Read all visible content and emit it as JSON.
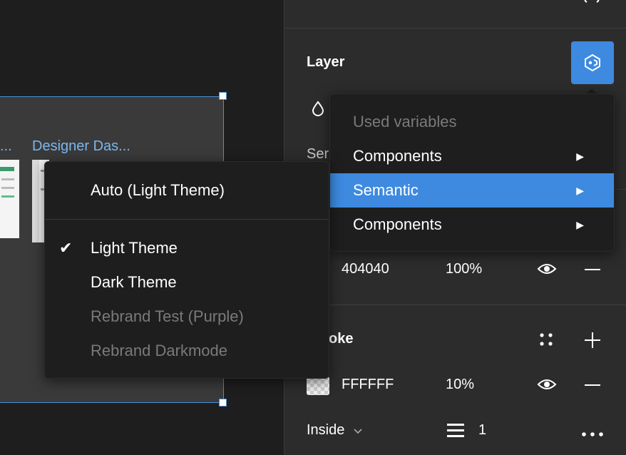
{
  "canvas": {
    "frame_titles": [
      "...",
      "Designer Das..."
    ]
  },
  "panel": {
    "layer": {
      "title": "Layer"
    },
    "section_partial": "Ser",
    "fill": {
      "hex": "404040",
      "opacity": "100%"
    },
    "stroke": {
      "title": "Stroke",
      "visible_title": "oke",
      "hex": "FFFFFF",
      "opacity": "10%",
      "position": "Inside",
      "weight": "1"
    }
  },
  "variables_menu": {
    "header": "Used variables",
    "items": [
      {
        "label": "Components",
        "selected": false
      },
      {
        "label": "Semantic",
        "selected": true
      },
      {
        "label": "Components",
        "selected": false
      }
    ]
  },
  "mode_menu": {
    "items": [
      {
        "label": "Auto (Light Theme)",
        "checked": false,
        "disabled": false
      },
      {
        "label": "Light Theme",
        "checked": true,
        "disabled": false
      },
      {
        "label": "Dark Theme",
        "checked": false,
        "disabled": false
      },
      {
        "label": "Rebrand Test (Purple)",
        "checked": false,
        "disabled": true
      },
      {
        "label": "Rebrand Darkmode",
        "checked": false,
        "disabled": true
      }
    ]
  },
  "colors": {
    "accent": "#3d8ae0",
    "frame_border": "#4a90d9",
    "panel_bg": "#2c2c2c",
    "menu_bg": "#1e1e1e"
  }
}
